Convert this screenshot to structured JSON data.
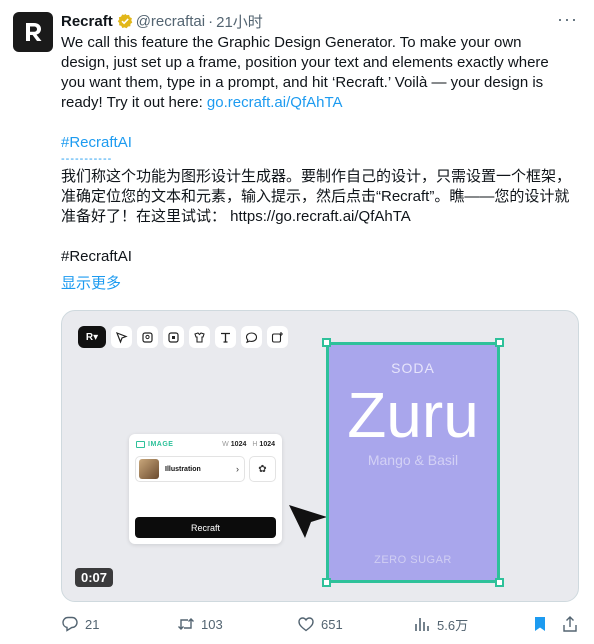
{
  "author": {
    "name": "Recraft",
    "handle": "@recraftai",
    "separator": "·",
    "time": "21小时",
    "more": "···"
  },
  "tweet": {
    "line1": "We call this feature the Graphic Design Generator. To make your own",
    "line2": "design, just set up a frame, position your text and elements exactly where",
    "line3": "you want them, type in a prompt, and hit ‘Recraft.’ Voilà — your design is",
    "line4_prefix": "ready! Try it out here: ",
    "link": "go.recraft.ai/QfAhTA",
    "hashtag1": "#RecraftAI",
    "separator_line": "-----------",
    "cn_line1": "我们称这个功能为图形设计生成器。要制作自己的设计，只需设置一个框架，",
    "cn_line2": "准确定位您的文本和元素，输入提示，然后点击“Recraft”。瞧——您的设计就",
    "cn_line3": "准备好了！在这里试试： https://go.recraft.ai/QfAhTA",
    "hashtag2": "#RecraftAI",
    "show_more": "显示更多"
  },
  "media": {
    "panel": {
      "header": "IMAGE",
      "w_label": "W",
      "width": "1024",
      "h_label": "H",
      "height": "1024",
      "style": "Illustration",
      "button": "Recraft"
    },
    "design": {
      "top": "SODA",
      "title": "Zuru",
      "subtitle": "Mango & Basil",
      "bottom": "ZERO SUGAR"
    },
    "duration": "0:07"
  },
  "actions": {
    "replies": "21",
    "retweets": "103",
    "likes": "651",
    "views": "5.6万"
  },
  "colors": {
    "link": "#1d9bf0",
    "frame_border": "#2ec19a",
    "frame_fill": "#a9a6ec",
    "bookmark": "#1d9bf0"
  }
}
